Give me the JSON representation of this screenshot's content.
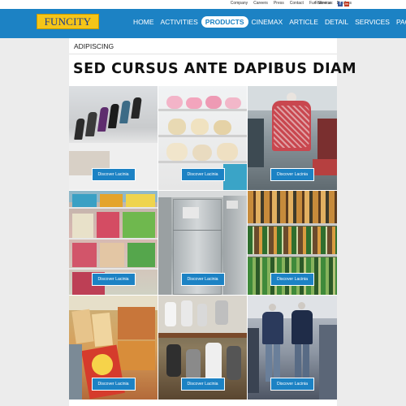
{
  "topbar": {
    "links": [
      "Company",
      "Careers",
      "Press",
      "Contact",
      "Fun Service",
      "Dapibus"
    ],
    "follow_label": "Follow us:",
    "social": [
      {
        "icon": "facebook-icon",
        "glyph": "f",
        "color": "#3b5998"
      },
      {
        "icon": "linkedin-icon",
        "glyph": "in",
        "color": "#c23b22"
      }
    ]
  },
  "header": {
    "logo": "FUNCITY",
    "nav": [
      {
        "label": "HOME",
        "active": false
      },
      {
        "label": "ACTIVITIES",
        "active": false
      },
      {
        "label": "PRODUCTS",
        "active": true
      },
      {
        "label": "CINEMAX",
        "active": false
      },
      {
        "label": "ARTICLE",
        "active": false
      },
      {
        "label": "DETAIL",
        "active": false
      },
      {
        "label": "SERVICES",
        "active": false
      },
      {
        "label": "PAGES",
        "active": false
      }
    ]
  },
  "main": {
    "subtitle": "ADIPISCING",
    "title": "SED CURSUS ANTE DAPIBUS DIAM",
    "tiles": [
      {
        "scene": "irons-display",
        "button": "Discover Lacinia"
      },
      {
        "scene": "teddy-bears-shelves",
        "button": "Discover Lacinia"
      },
      {
        "scene": "shirt-mannequin",
        "button": "Discover Lacinia"
      },
      {
        "scene": "folded-clothes-shelves",
        "button": "Discover Lacinia"
      },
      {
        "scene": "refrigerators",
        "button": "Discover Lacinia"
      },
      {
        "scene": "bottles-shelves",
        "button": "Discover Lacinia"
      },
      {
        "scene": "grocery-bags",
        "button": "Discover Lacinia"
      },
      {
        "scene": "mixers-appliances",
        "button": "Discover Lacinia"
      },
      {
        "scene": "menswear-mannequins",
        "button": "Discover Lacinia"
      }
    ]
  },
  "colors": {
    "accent": "#1c82c4",
    "logo_bg": "#f5c518",
    "logo_text": "#1b3a8a"
  }
}
